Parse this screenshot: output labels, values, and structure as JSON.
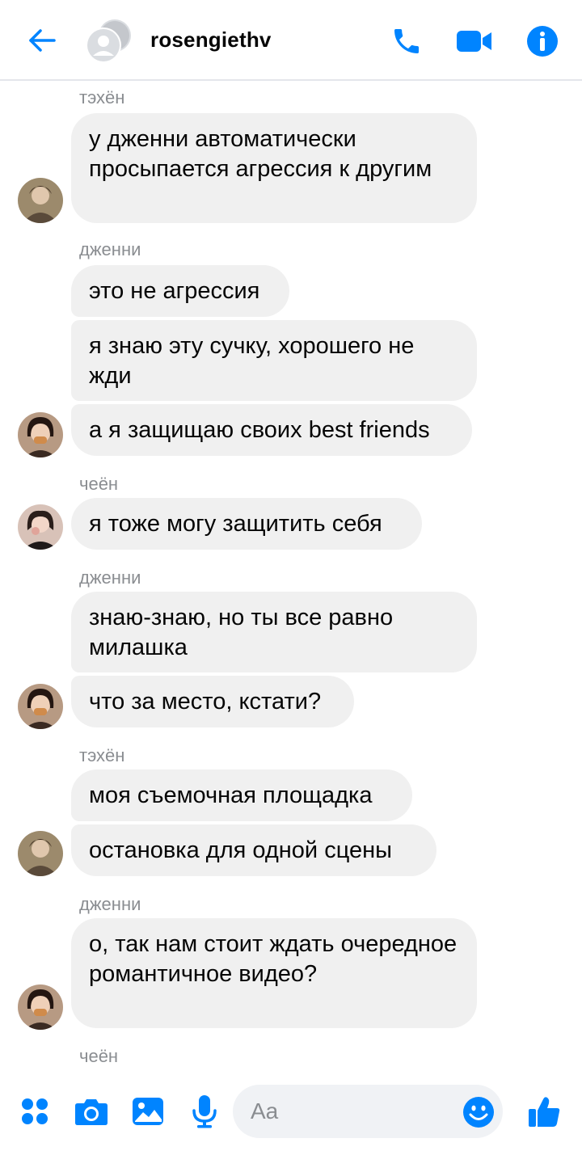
{
  "header": {
    "title": "rosengiethv",
    "icons": [
      "back-arrow-icon",
      "phone-icon",
      "video-camera-icon",
      "info-icon"
    ],
    "accent_color": "#0084ff"
  },
  "messages": [
    {
      "sender": "тэхён",
      "bubbles": [
        "у дженни автоматически просыпается агрессия к другим"
      ]
    },
    {
      "sender": "дженни",
      "bubbles": [
        "это не агрессия",
        "я знаю эту сучку, хорошего не жди",
        "а я защищаю своих best friends"
      ]
    },
    {
      "sender": "чеён",
      "bubbles": [
        "я тоже могу защитить себя"
      ]
    },
    {
      "sender": "дженни",
      "bubbles": [
        "знаю-знаю, но ты все равно милашка",
        "что за место, кстати?"
      ]
    },
    {
      "sender": "тэхён",
      "bubbles": [
        "моя съемочная площадка",
        "остановка для одной сцены"
      ]
    },
    {
      "sender": "дженни",
      "bubbles": [
        "о, так нам стоит ждать очередное романтичное видео?"
      ]
    },
    {
      "sender": "чеён",
      "bubbles": []
    }
  ],
  "composer": {
    "placeholder": "Aa",
    "icons": [
      "menu-dots-icon",
      "camera-icon",
      "gallery-icon",
      "microphone-icon",
      "emoji-icon",
      "thumbs-up-icon"
    ]
  }
}
